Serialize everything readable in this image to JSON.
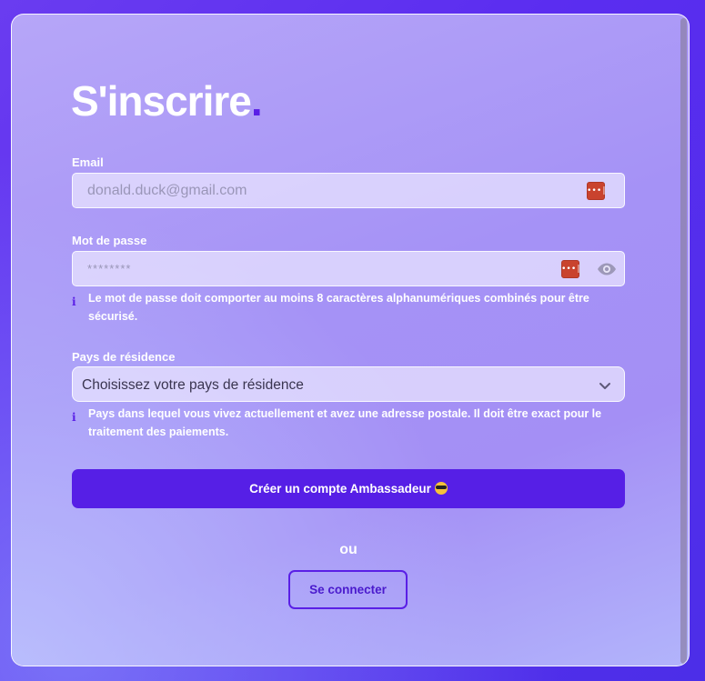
{
  "form": {
    "title": "S'inscrire",
    "title_dot": ".",
    "email": {
      "label": "Email",
      "placeholder": "donald.duck@gmail.com",
      "value": ""
    },
    "password": {
      "label": "Mot de passe",
      "placeholder": "********",
      "value": "",
      "hint": "Le mot de passe doit comporter au moins 8 caractères alphanumériques combinés pour être sécurisé."
    },
    "country": {
      "label": "Pays de résidence",
      "selected": "Choisissez votre pays de résidence",
      "hint": "Pays dans lequel vous vivez actuellement et avez une adresse postale. Il doit être exact pour le traitement des paiements."
    },
    "info_symbol": "i",
    "password_manager_glyph": "•••|",
    "submit_label": "Créer un compte Ambassadeur",
    "or_label": "ou",
    "login_label": "Se connecter"
  },
  "icons": {
    "password_manager": "key-icon",
    "eye": "eye-icon",
    "chevron": "chevron-down-icon",
    "info": "info-icon",
    "emoji": "sunglasses-emoji-icon"
  },
  "colors": {
    "accent": "#561fe6",
    "password_manager": "#c9432e",
    "text_light": "#ffffff"
  }
}
